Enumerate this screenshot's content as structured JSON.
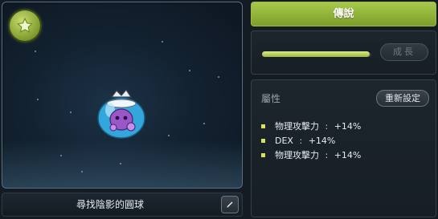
{
  "preview": {
    "grade_icon": "star-icon",
    "item_name": "尋找陰影的圓球",
    "edit_icon": "pencil-icon"
  },
  "rank": {
    "label": "傳說"
  },
  "growth": {
    "button_label": "成長",
    "progress": 0.98
  },
  "attributes": {
    "title": "屬性",
    "reset_label": "重新設定",
    "items": [
      {
        "name": "物理攻擊力",
        "sep": ":",
        "value": "+14%"
      },
      {
        "name": "DEX",
        "sep": ":",
        "value": "+14%"
      },
      {
        "name": "物理攻擊力",
        "sep": ":",
        "value": "+14%"
      }
    ]
  },
  "colors": {
    "accent": "#8fb23a",
    "bullet": "#d7e45a"
  }
}
